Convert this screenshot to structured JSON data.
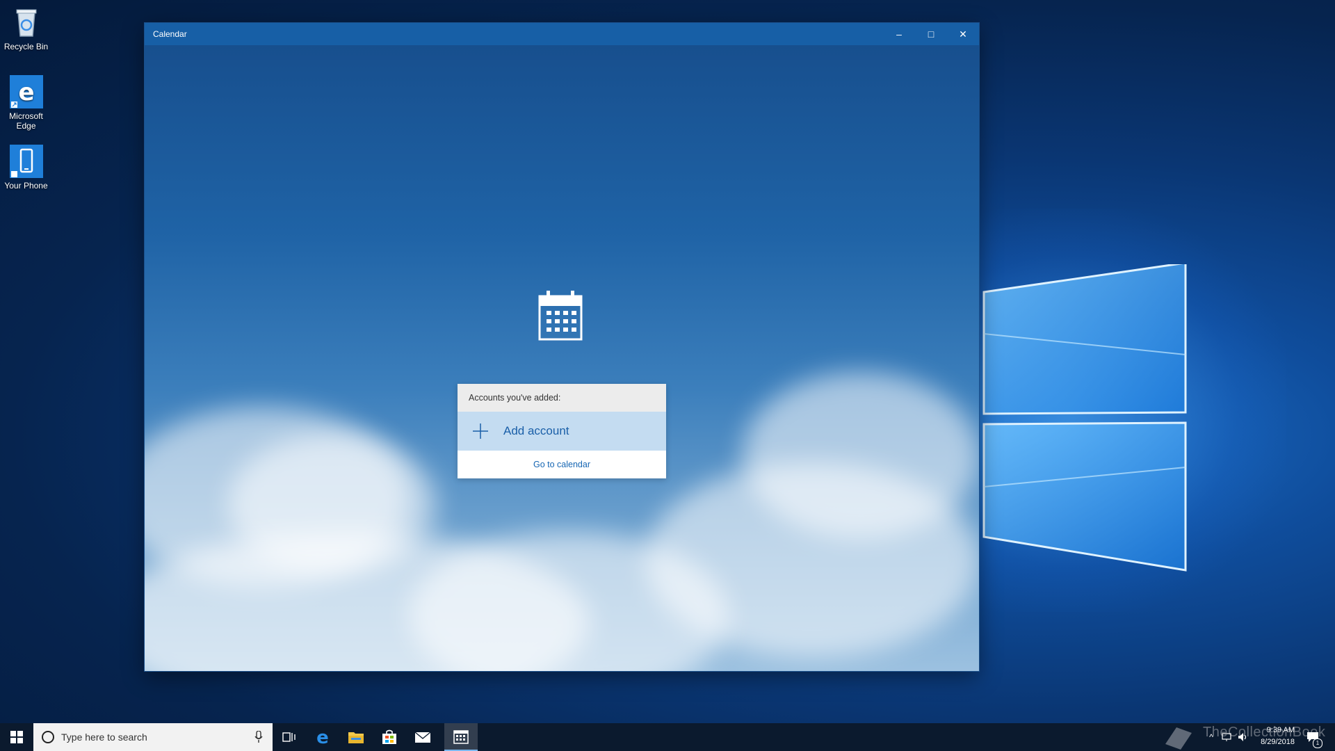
{
  "desktop": {
    "icons": [
      {
        "label": "Recycle Bin"
      },
      {
        "label": "Microsoft Edge"
      },
      {
        "label": "Your Phone"
      }
    ]
  },
  "window": {
    "title": "Calendar",
    "controls": {
      "minimize": "–",
      "maximize": "□",
      "close": "✕"
    }
  },
  "accounts_panel": {
    "header": "Accounts you've added:",
    "add_account": "Add account",
    "go_to_calendar": "Go to calendar"
  },
  "taskbar": {
    "search_placeholder": "Type here to search",
    "pinned": [
      "task-view-icon",
      "edge-icon",
      "file-explorer-icon",
      "store-icon",
      "mail-icon",
      "calendar-icon"
    ],
    "active_app": "calendar-icon",
    "clock": {
      "time": "9:39 AM",
      "date": "8/29/2018"
    },
    "notification_count": "1",
    "watermark": "TheCollectionBook"
  },
  "colors": {
    "window_titlebar": "#175fa6",
    "accent": "#1a5fa8",
    "taskbar": "#0b1a2e"
  }
}
